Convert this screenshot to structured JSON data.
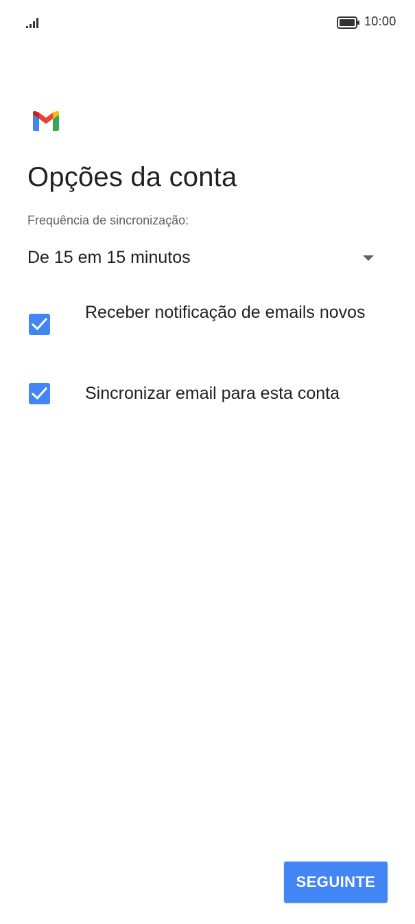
{
  "status_bar": {
    "time": "10:00",
    "signal_icon": "signal-bars-icon",
    "battery_icon": "battery-full-icon"
  },
  "app": {
    "logo_icon": "gmail-logo-icon"
  },
  "page": {
    "title": "Opções da conta",
    "sync_frequency": {
      "label": "Frequência de sincronização:",
      "value": "De 15 em 15 minutos"
    },
    "options": [
      {
        "label": "Receber notificação de emails novos",
        "checked": true
      },
      {
        "label": "Sincronizar email para esta conta",
        "checked": true
      }
    ],
    "next_label": "SEGUINTE"
  },
  "colors": {
    "accent": "#4285f4",
    "text_primary": "#202124",
    "text_secondary": "#5f6368"
  }
}
